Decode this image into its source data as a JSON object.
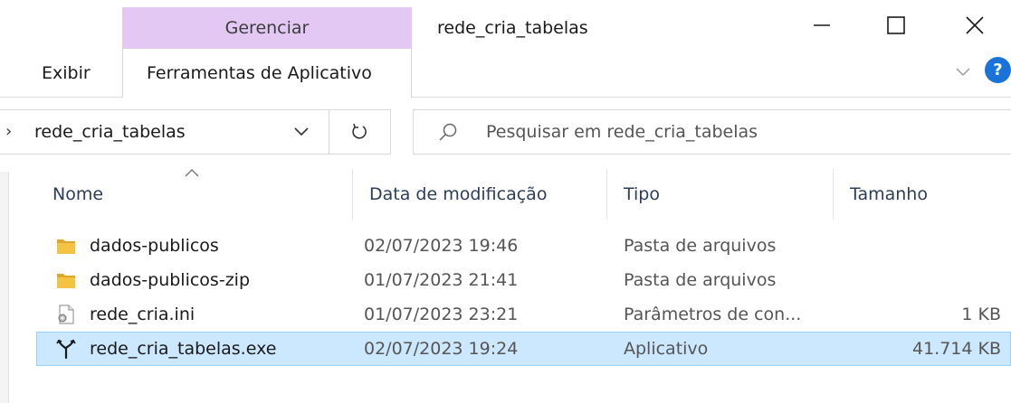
{
  "window": {
    "manage_tab_label": "Gerenciar",
    "title": "rede_cria_tabelas"
  },
  "ribbon": {
    "tabs": [
      {
        "label": "Exibir"
      },
      {
        "label": "Ferramentas de Aplicativo"
      }
    ],
    "help_label": "?"
  },
  "address": {
    "prefix": "›",
    "path": "rede_cria_tabelas"
  },
  "search": {
    "placeholder": "Pesquisar em rede_cria_tabelas"
  },
  "columns": {
    "name": "Nome",
    "date": "Data de modificação",
    "type": "Tipo",
    "size": "Tamanho"
  },
  "files": [
    {
      "name": "dados-publicos",
      "date": "02/07/2023 19:46",
      "type": "Pasta de arquivos",
      "size": "",
      "icon": "folder-icon"
    },
    {
      "name": "dados-publicos-zip",
      "date": "01/07/2023 21:41",
      "type": "Pasta de arquivos",
      "size": "",
      "icon": "folder-icon"
    },
    {
      "name": "rede_cria.ini",
      "date": "01/07/2023 23:21",
      "type": "Parâmetros de con...",
      "size": "1 KB",
      "icon": "settings-file-icon"
    },
    {
      "name": "rede_cria_tabelas.exe",
      "date": "02/07/2023 19:24",
      "type": "Aplicativo",
      "size": "41.714 KB",
      "icon": "application-icon"
    }
  ],
  "colors": {
    "manage_tab_bg": "#e3c8f4",
    "selection_bg": "#cce8ff",
    "selection_border": "#99d1ff",
    "folder": "#f5c342",
    "help": "#1a73d9"
  }
}
